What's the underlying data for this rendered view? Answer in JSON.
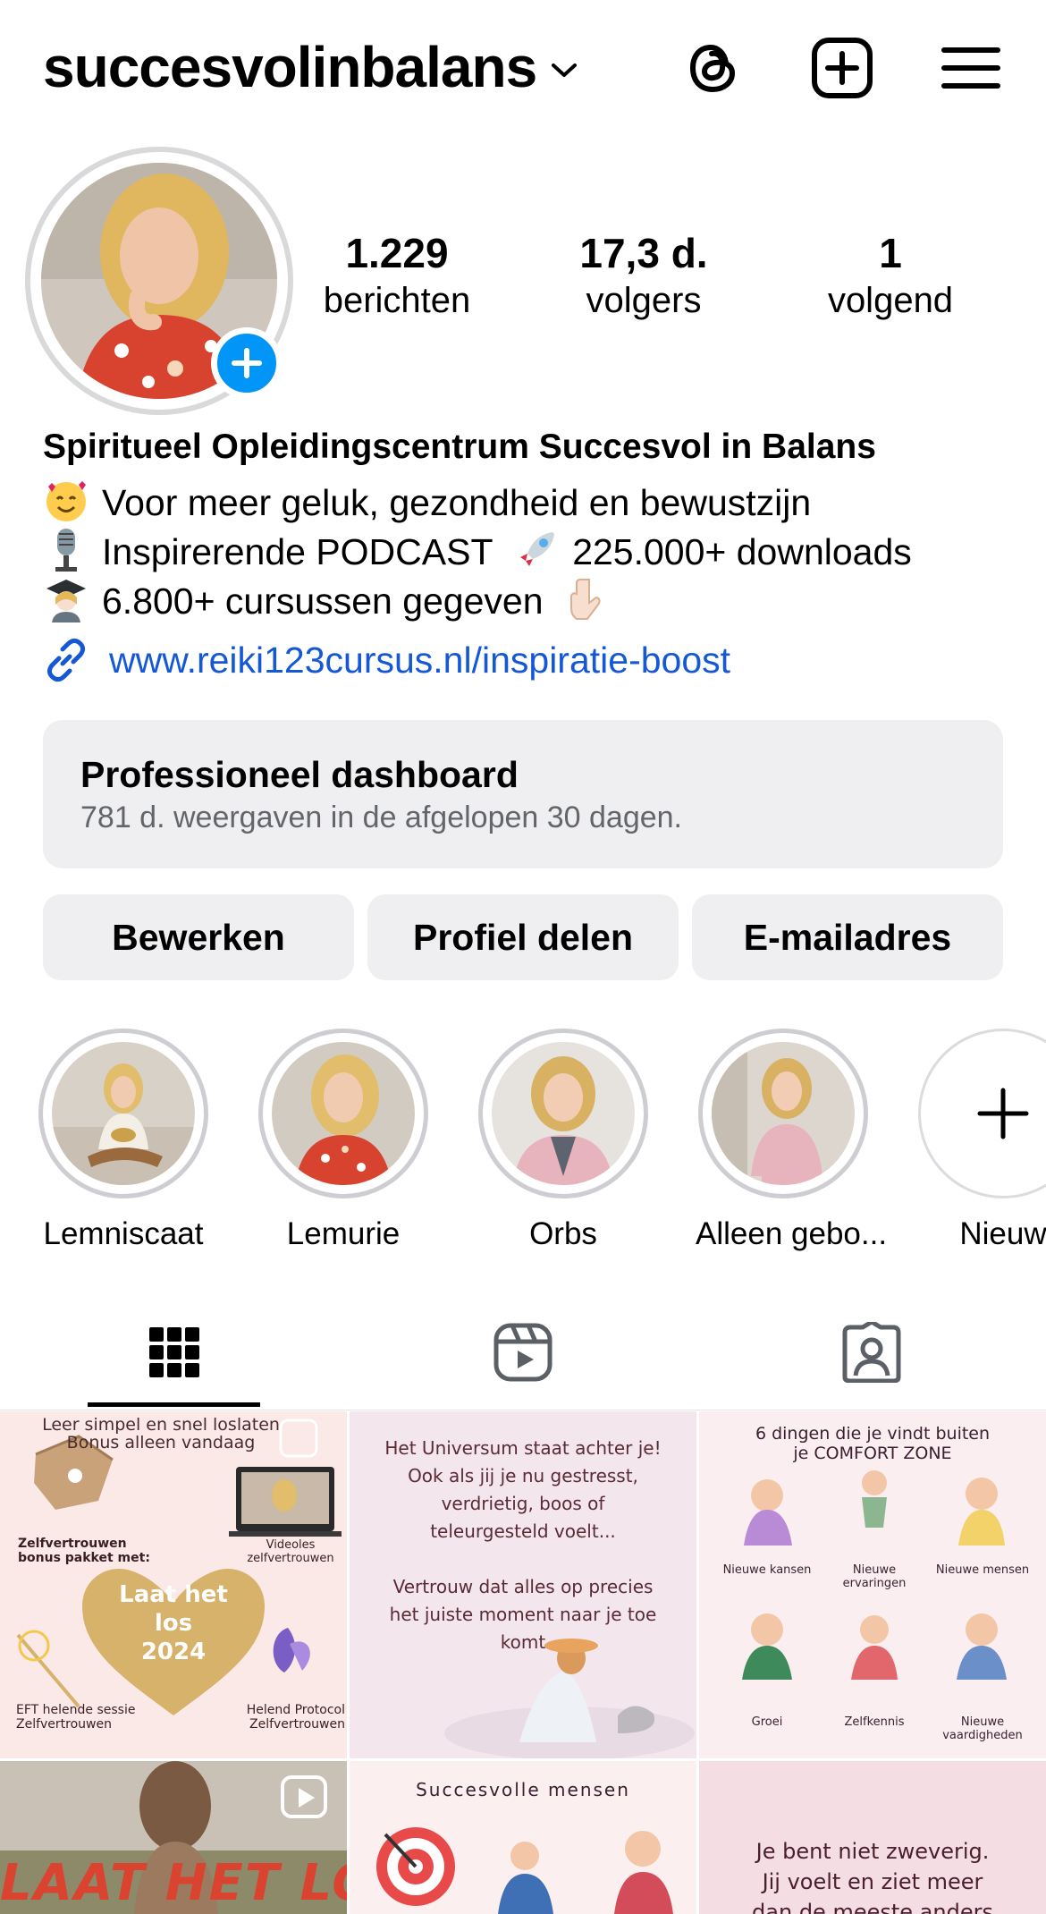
{
  "header": {
    "username": "succesvolinbalans"
  },
  "profile": {
    "stats": [
      {
        "num": "1.229",
        "label": "berichten"
      },
      {
        "num": "17,3 d.",
        "label": "volgers"
      },
      {
        "num": "1",
        "label": "volgend"
      }
    ],
    "name": "Spiritueel Opleidingscentrum Succesvol in Balans",
    "bio_lines": [
      "Voor meer geluk, gezondheid en bewustzijn",
      "Inspirerende PODCAST",
      "225.000+ downloads",
      "6.800+ cursussen gegeven"
    ],
    "link": "www.reiki123cursus.nl/inspiratie-boost"
  },
  "dashboard": {
    "title": "Professioneel dashboard",
    "subtitle": "781 d. weergaven in de afgelopen 30 dagen."
  },
  "actions": [
    "Bewerken",
    "Profiel delen",
    "E-mailadres"
  ],
  "highlights": [
    "Lemniscaat",
    "Lemurie",
    "Orbs",
    "Alleen gebo...",
    "Nieuw"
  ],
  "posts": {
    "p1": {
      "top": "Leer simpel en snel loslaten",
      "sub": "Bonus alleen vandaag",
      "bonus": "Zelfvertrouwen bonus pakket met:",
      "video": "Videoles zelfvertrouwen",
      "heart": [
        "Laat het",
        "los",
        "2024"
      ],
      "eft": "EFT helende sessie Zelfvertrouwen",
      "protocol": "Helend Protocol Zelfvertrouwen"
    },
    "p2": {
      "lines": [
        "Het Universum staat achter je!",
        "Ook als jij je nu gestresst,",
        "verdrietig, boos of",
        "teleurgesteld voelt...",
        "",
        "Vertrouw dat alles op precies",
        "het juiste moment naar je toe",
        "komt"
      ]
    },
    "p3": {
      "title1": "6 dingen die je vindt buiten",
      "title2": "je COMFORT ZONE",
      "items": [
        "Nieuwe kansen",
        "Nieuwe ervaringen",
        "Nieuwe mensen",
        "Groei",
        "Zelfkennis",
        "Nieuwe vaardigheden"
      ]
    },
    "p4": {
      "text": "LAAT HET LOS!"
    },
    "p5": {
      "title": "Succesvolle mensen"
    },
    "p6": {
      "lines": [
        "Je bent niet zweverig.",
        "Jij voelt en ziet meer",
        "dan de meeste anders"
      ]
    }
  },
  "colors": {
    "accent": "#0095f6",
    "link": "#1558d6",
    "button_bg": "#efeff1"
  }
}
